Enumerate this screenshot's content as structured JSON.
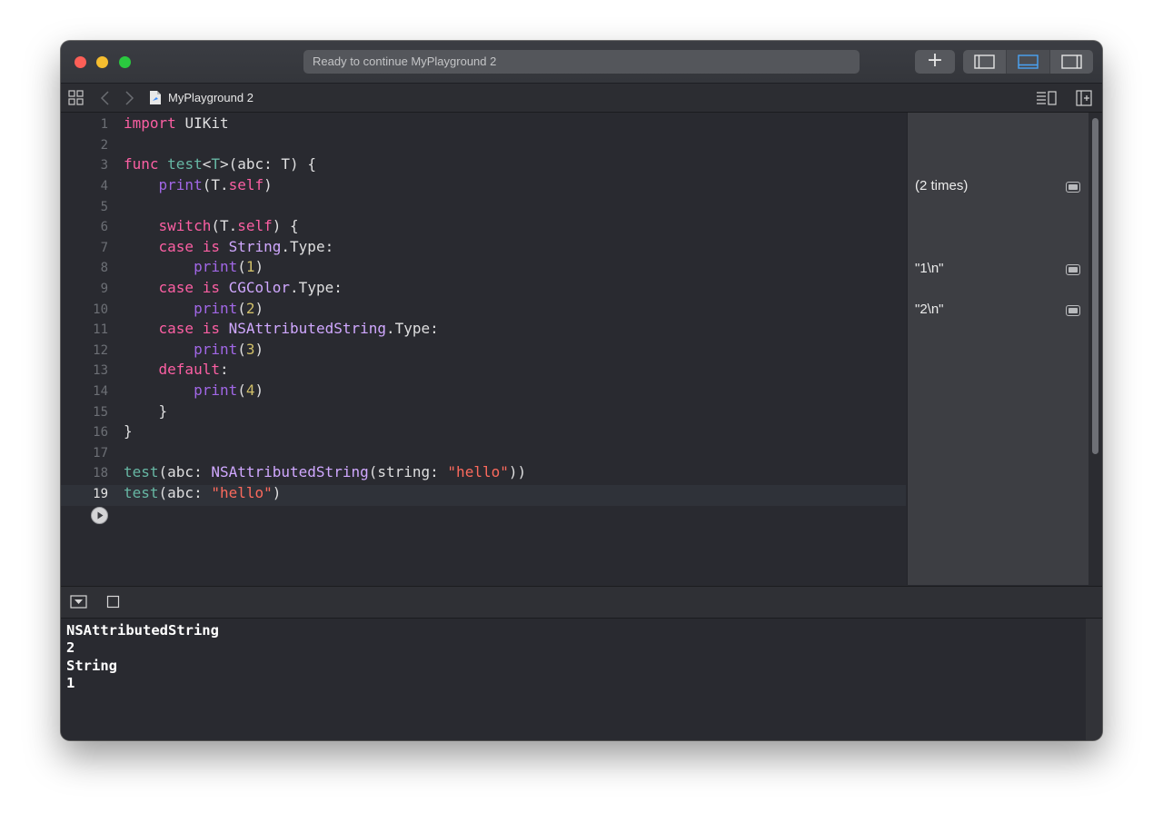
{
  "window": {
    "activity_text": "Ready to continue MyPlayground 2",
    "add_button_label": "+"
  },
  "jumpbar": {
    "file_name": "MyPlayground 2"
  },
  "editor": {
    "lines": [
      {
        "num": "1"
      },
      {
        "num": "2"
      },
      {
        "num": "3"
      },
      {
        "num": "4"
      },
      {
        "num": "5"
      },
      {
        "num": "6"
      },
      {
        "num": "7"
      },
      {
        "num": "8"
      },
      {
        "num": "9"
      },
      {
        "num": "10"
      },
      {
        "num": "11"
      },
      {
        "num": "12"
      },
      {
        "num": "13"
      },
      {
        "num": "14"
      },
      {
        "num": "15"
      },
      {
        "num": "16"
      },
      {
        "num": "17"
      },
      {
        "num": "18"
      },
      {
        "num": "19"
      }
    ],
    "tokens": {
      "import": "import",
      "uikit": "UIKit",
      "func": "func",
      "test": "test",
      "generic_open": "<",
      "T": "T",
      "generic_close": ">",
      "sig_rest": "(abc: T) {",
      "print": "print",
      "paren_open": "(",
      "T_self_T": "T.",
      "self": "self",
      "paren_close": ")",
      "switch": "switch",
      "switch_rest": ") {",
      "case": "case",
      "is": "is",
      "String": "String",
      "CGColor": "CGColor",
      "NSAttributedString": "NSAttributedString",
      "dot_type": ".Type:",
      "n1": "1",
      "n2": "2",
      "n3": "3",
      "n4": "4",
      "default": "default",
      "colon": ":",
      "close_brace": "}",
      "abc_label": "(abc: ",
      "string_label": "(string: ",
      "hello": "\"hello\"",
      "double_close": "))"
    }
  },
  "results": {
    "items": [
      "(2 times)",
      "\"1\\n\"",
      "\"2\\n\""
    ]
  },
  "console": {
    "lines": [
      "NSAttributedString",
      "2",
      "String",
      "1"
    ]
  }
}
